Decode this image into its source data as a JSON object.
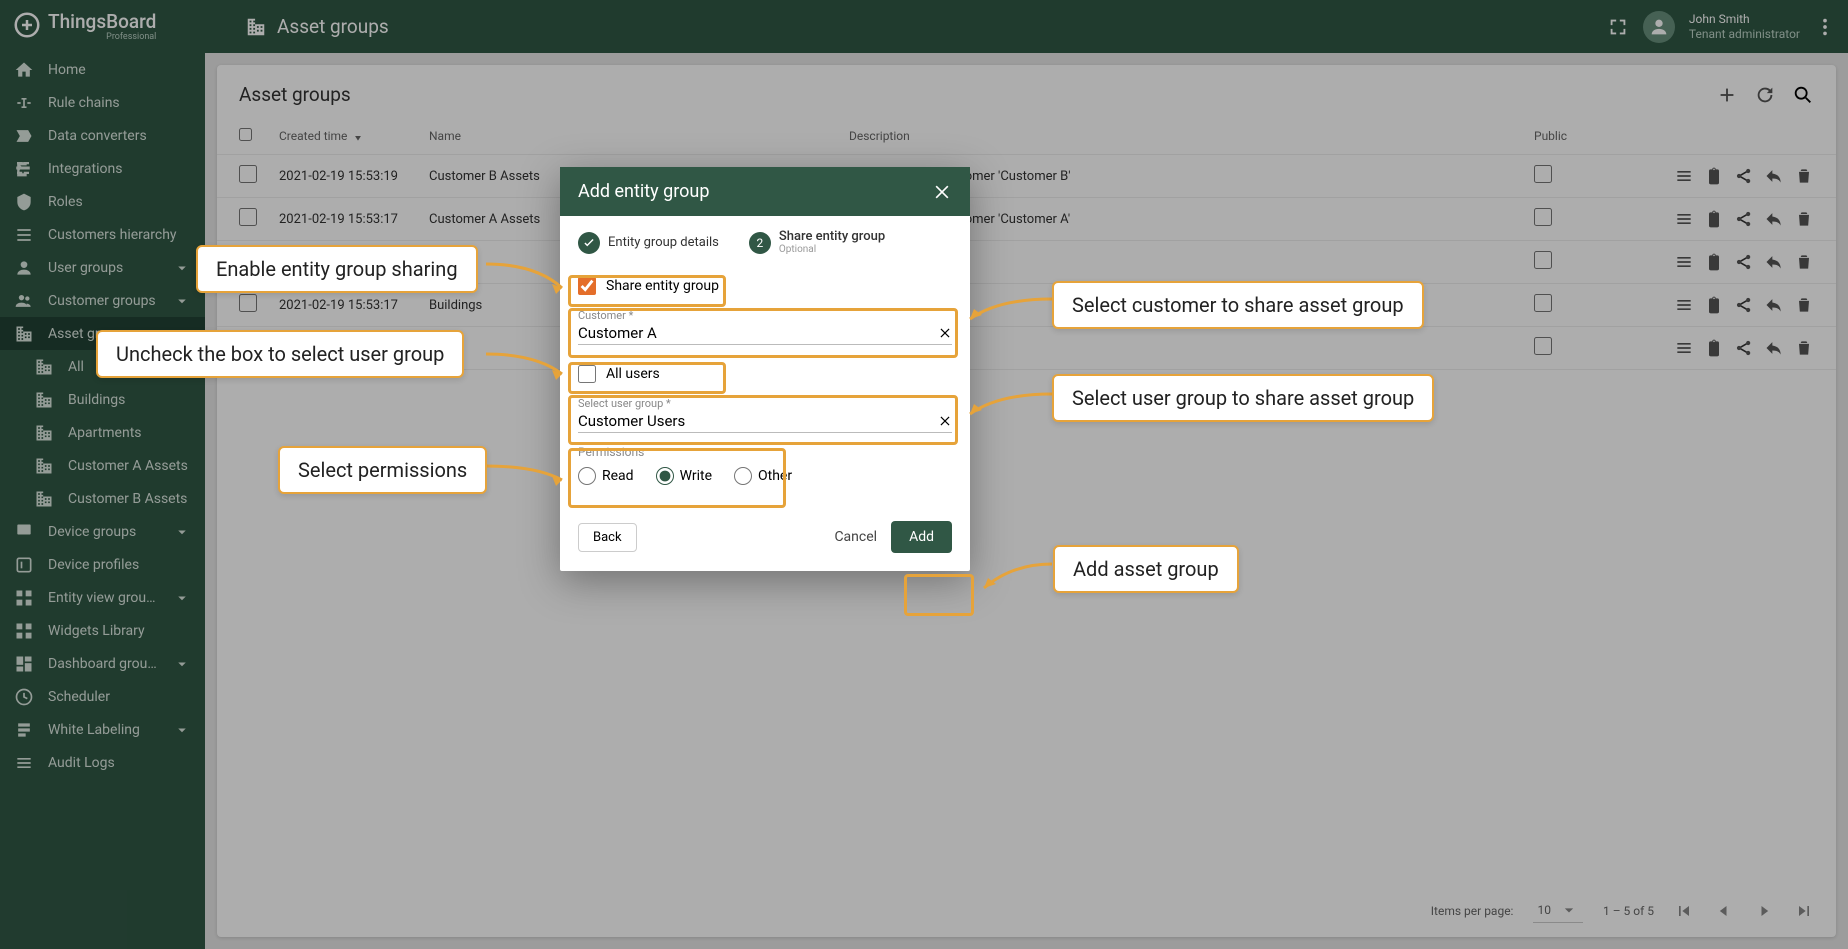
{
  "brand": {
    "name": "ThingsBoard",
    "tier": "Professional"
  },
  "header": {
    "title": "Asset groups",
    "user_name": "John Smith",
    "user_role": "Tenant administrator"
  },
  "sidebar": {
    "items": [
      {
        "label": "Home",
        "icon": "home"
      },
      {
        "label": "Rule chains",
        "icon": "rulechains"
      },
      {
        "label": "Data converters",
        "icon": "converters"
      },
      {
        "label": "Integrations",
        "icon": "integrations"
      },
      {
        "label": "Roles",
        "icon": "roles"
      },
      {
        "label": "Customers hierarchy",
        "icon": "hierarchy"
      },
      {
        "label": "User groups",
        "icon": "usergroups",
        "expandable": true
      },
      {
        "label": "Customer groups",
        "icon": "customergroups",
        "expandable": true
      },
      {
        "label": "Asset groups",
        "icon": "assetgroups",
        "expandable": true,
        "active": true,
        "children": [
          {
            "label": "All"
          },
          {
            "label": "Buildings"
          },
          {
            "label": "Apartments"
          },
          {
            "label": "Customer A Assets"
          },
          {
            "label": "Customer B Assets"
          }
        ]
      },
      {
        "label": "Device groups",
        "icon": "devicegroups",
        "expandable": true
      },
      {
        "label": "Device profiles",
        "icon": "deviceprofiles"
      },
      {
        "label": "Entity view groups",
        "icon": "entityview",
        "expandable": true
      },
      {
        "label": "Widgets Library",
        "icon": "widgets"
      },
      {
        "label": "Dashboard groups",
        "icon": "dashboard",
        "expandable": true
      },
      {
        "label": "Scheduler",
        "icon": "scheduler"
      },
      {
        "label": "White Labeling",
        "icon": "whitelabel",
        "expandable": true
      },
      {
        "label": "Audit Logs",
        "icon": "audit"
      }
    ]
  },
  "table": {
    "title": "Asset groups",
    "columns": {
      "created": "Created time",
      "name": "Name",
      "desc": "Description",
      "public": "Public"
    },
    "rows": [
      {
        "created": "2021-02-19 15:53:19",
        "name": "Customer B Assets",
        "desc": "only access for customer 'Customer B'"
      },
      {
        "created": "2021-02-19 15:53:17",
        "name": "Customer A Assets",
        "desc": "only access for customer 'Customer A'"
      },
      {
        "created": "",
        "name": "",
        "desc": ""
      },
      {
        "created": "2021-02-19 15:53:17",
        "name": "Buildings",
        "desc": ""
      },
      {
        "created": "",
        "name": "",
        "desc": ""
      }
    ],
    "footer": {
      "items_per_page_label": "Items per page:",
      "items_per_page_value": "10",
      "range": "1 – 5 of 5"
    }
  },
  "modal": {
    "title": "Add entity group",
    "step1_label": "Entity group details",
    "step2_label": "Share entity group",
    "step2_optional": "Optional",
    "share_checkbox": "Share entity group",
    "customer_label": "Customer *",
    "customer_value": "Customer A",
    "allusers_label": "All users",
    "usergroup_label": "Select user group *",
    "usergroup_value": "Customer Users",
    "permissions_label": "Permissions",
    "perm_read": "Read",
    "perm_write": "Write",
    "perm_other": "Other",
    "btn_back": "Back",
    "btn_cancel": "Cancel",
    "btn_add": "Add"
  },
  "callouts": {
    "c1": "Enable entity group sharing",
    "c2": "Uncheck the box to select user group",
    "c3": "Select permissions",
    "c4": "Select customer to share asset group",
    "c5": "Select user group to share asset group",
    "c6": "Add asset group"
  }
}
